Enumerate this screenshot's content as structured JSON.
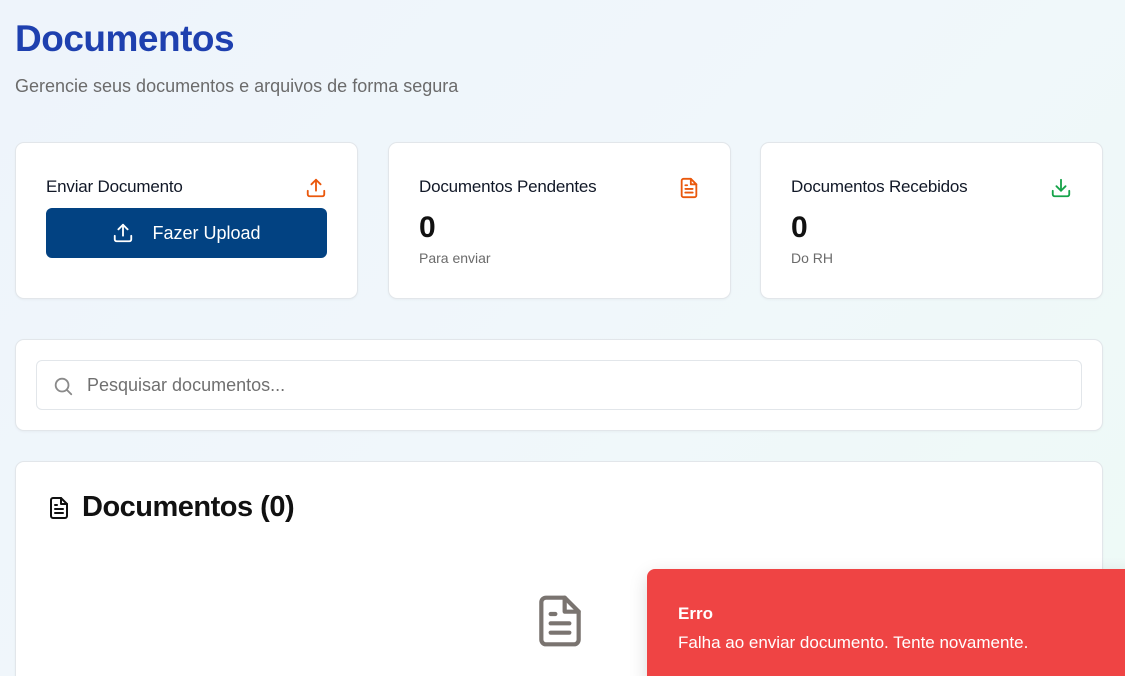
{
  "header": {
    "title": "Documentos",
    "subtitle": "Gerencie seus documentos e arquivos de forma segura"
  },
  "upload_card": {
    "title": "Enviar Documento",
    "icon": "upload-icon",
    "button_label": "Fazer Upload",
    "accent": "#ea580c"
  },
  "pending_card": {
    "title": "Documentos Pendentes",
    "icon": "file-text-icon",
    "value": "0",
    "caption": "Para enviar",
    "accent": "#ea580c"
  },
  "received_card": {
    "title": "Documentos Recebidos",
    "icon": "download-icon",
    "value": "0",
    "caption": "Do RH",
    "accent": "#16a34a"
  },
  "search": {
    "placeholder": "Pesquisar documentos...",
    "value": ""
  },
  "documents": {
    "heading": "Documentos (0)"
  },
  "toast": {
    "title": "Erro",
    "message": "Falha ao enviar documento. Tente novamente.",
    "color": "#ef4444"
  },
  "colors": {
    "title": "#1e40af",
    "primary_button": "#024282"
  }
}
